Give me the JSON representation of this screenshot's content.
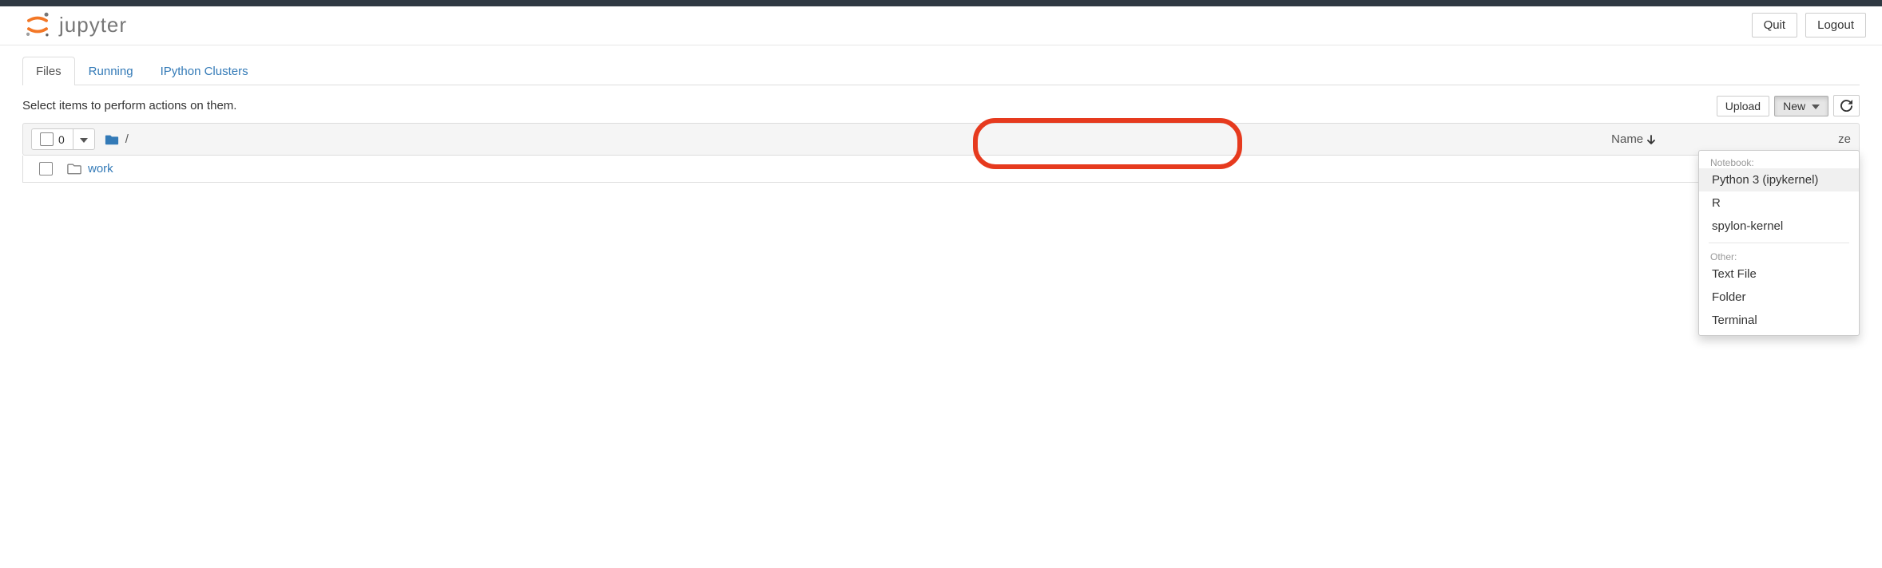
{
  "header": {
    "brand": "jupyter",
    "quit": "Quit",
    "logout": "Logout"
  },
  "tabs": {
    "items": [
      {
        "label": "Files",
        "active": true
      },
      {
        "label": "Running",
        "active": false
      },
      {
        "label": "IPython Clusters",
        "active": false
      }
    ]
  },
  "toolbar": {
    "hint": "Select items to perform actions on them.",
    "upload": "Upload",
    "new": "New",
    "refresh_icon": "refresh-icon"
  },
  "listhead": {
    "selected_count": "0",
    "breadcrumb": "/",
    "columns": {
      "name": "Name",
      "size_suffix": "ze"
    }
  },
  "rows": [
    {
      "type": "folder",
      "name": "work"
    }
  ],
  "dropdown": {
    "section1_label": "Notebook:",
    "section1_items": [
      "Python 3 (ipykernel)",
      "R",
      "spylon-kernel"
    ],
    "section2_label": "Other:",
    "section2_items": [
      "Text File",
      "Folder",
      "Terminal"
    ]
  }
}
